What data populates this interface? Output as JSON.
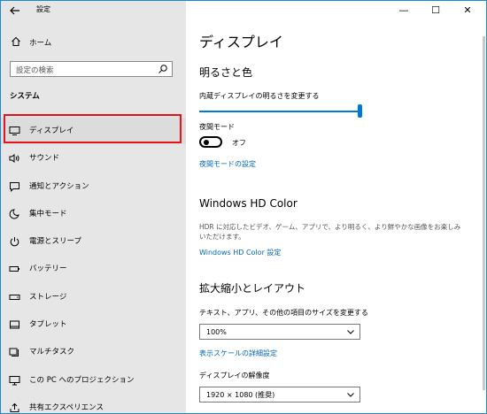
{
  "app": {
    "title": "設定"
  },
  "window_controls": {
    "minimize": "—",
    "maximize": "☐",
    "close": "✕"
  },
  "sidebar": {
    "home_label": "ホーム",
    "search_placeholder": "設定の検索",
    "section": "システム",
    "items": [
      {
        "label": "ディスプレイ",
        "icon": "monitor-icon"
      },
      {
        "label": "サウンド",
        "icon": "speaker-icon"
      },
      {
        "label": "通知とアクション",
        "icon": "notification-icon"
      },
      {
        "label": "集中モード",
        "icon": "moon-icon"
      },
      {
        "label": "電源とスリープ",
        "icon": "power-icon"
      },
      {
        "label": "バッテリー",
        "icon": "battery-icon"
      },
      {
        "label": "ストレージ",
        "icon": "storage-icon"
      },
      {
        "label": "タブレット",
        "icon": "tablet-icon"
      },
      {
        "label": "マルチタスク",
        "icon": "multitask-icon"
      },
      {
        "label": "この PC へのプロジェクション",
        "icon": "projection-icon"
      },
      {
        "label": "共有エクスペリエンス",
        "icon": "share-icon"
      }
    ],
    "selected_index": 0
  },
  "main": {
    "title": "ディスプレイ",
    "brightness": {
      "heading": "明るさと色",
      "slider_label": "内蔵ディスプレイの明るさを変更する",
      "slider_value_percent": 100,
      "night_mode_label": "夜間モード",
      "night_mode_state": "オフ",
      "night_mode_link": "夜間モードの設定"
    },
    "hdr": {
      "heading": "Windows HD Color",
      "description": "HDR に対応したビデオ、ゲーム、アプリで、より明るく、より鮮やかな画像をお楽しみいただけます。",
      "link": "Windows HD Color 設定"
    },
    "scale": {
      "heading": "拡大縮小とレイアウト",
      "size_label": "テキスト、アプリ、その他の項目のサイズを変更する",
      "size_value": "100%",
      "advanced_link": "表示スケールの詳細設定",
      "resolution_label": "ディスプレイの解像度",
      "resolution_value": "1920 × 1080 (推奨)"
    }
  },
  "colors": {
    "accent": "#0078d7",
    "link": "#0066b4",
    "highlight": "#e3141e",
    "sidebar_bg": "#e6e6e6"
  }
}
